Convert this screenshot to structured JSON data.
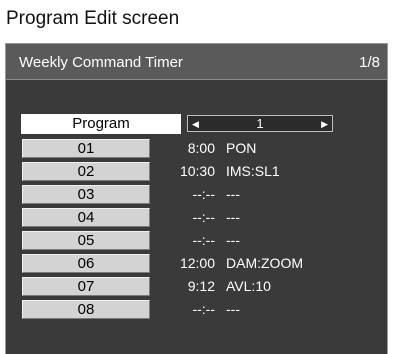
{
  "page_title": "Program Edit screen",
  "screen": {
    "title": "Weekly Command Timer",
    "page_indicator": "1/8",
    "program_label": "Program",
    "program_value": "1",
    "rows": [
      {
        "num": "01",
        "time": "8:00",
        "cmd": "PON"
      },
      {
        "num": "02",
        "time": "10:30",
        "cmd": "IMS:SL1"
      },
      {
        "num": "03",
        "time": "--:--",
        "cmd": "---"
      },
      {
        "num": "04",
        "time": "--:--",
        "cmd": "---"
      },
      {
        "num": "05",
        "time": "--:--",
        "cmd": "---"
      },
      {
        "num": "06",
        "time": "12:00",
        "cmd": "DAM:ZOOM"
      },
      {
        "num": "07",
        "time": "9:12",
        "cmd": "AVL:10"
      },
      {
        "num": "08",
        "time": "--:--",
        "cmd": "---"
      }
    ]
  },
  "colors": {
    "screen_bg": "#3a3a3a",
    "header_bg": "#5a5a5a",
    "button_bg": "#d3d3d3"
  }
}
